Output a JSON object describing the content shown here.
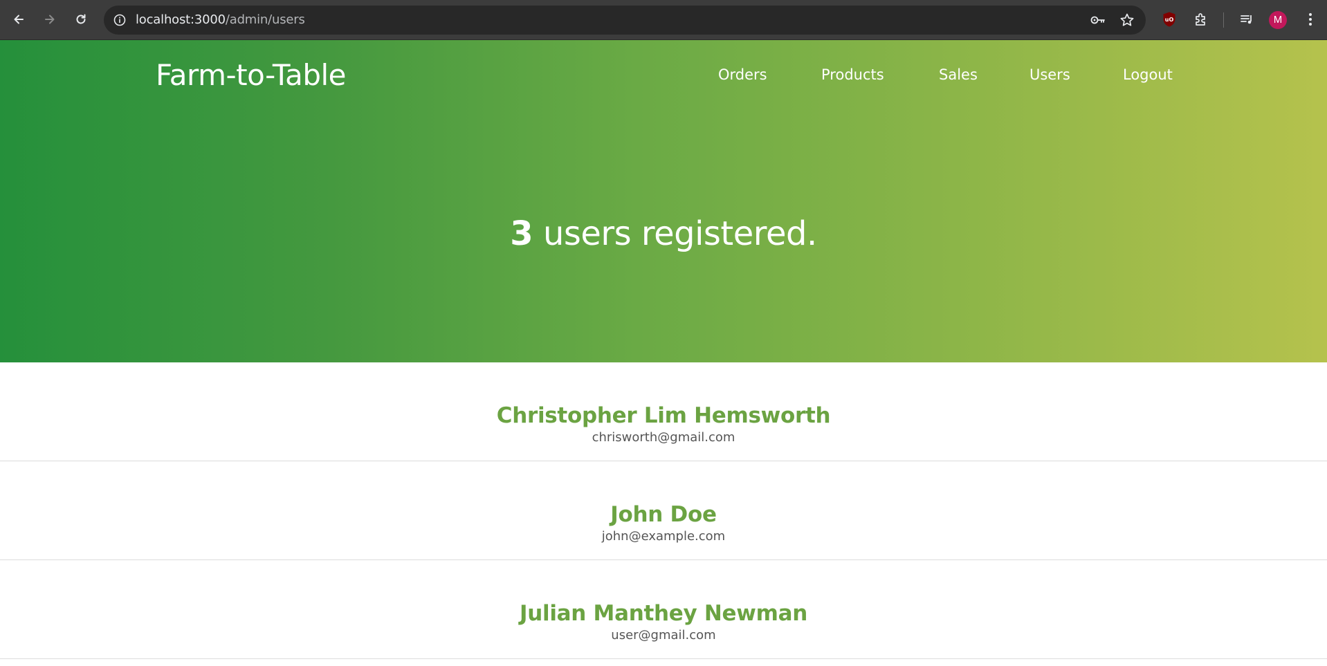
{
  "browser": {
    "url_host": "localhost:3000",
    "url_path": "/admin/users",
    "profile_initial": "M",
    "icons": [
      "back-icon",
      "forward-icon",
      "reload-icon",
      "site-info-icon",
      "password-key-icon",
      "bookmark-star-icon",
      "ublock-extension-icon",
      "extensions-puzzle-icon",
      "media-queue-icon",
      "menu-kebab-icon"
    ]
  },
  "header": {
    "brand": "Farm-to-Table",
    "nav": [
      {
        "label": "Orders"
      },
      {
        "label": "Products"
      },
      {
        "label": "Sales"
      },
      {
        "label": "Users"
      },
      {
        "label": "Logout"
      }
    ]
  },
  "hero": {
    "count": "3",
    "text": " users registered."
  },
  "users": [
    {
      "name": "Christopher Lim Hemsworth",
      "email": "chrisworth@gmail.com"
    },
    {
      "name": "John Doe",
      "email": "john@example.com"
    },
    {
      "name": "Julian Manthey Newman",
      "email": "user@gmail.com"
    }
  ],
  "colors": {
    "hero_gradient_start": "#25903b",
    "hero_gradient_end": "#b5c24d",
    "user_name": "#6ba342",
    "chrome_bg": "#3c3c3c"
  }
}
